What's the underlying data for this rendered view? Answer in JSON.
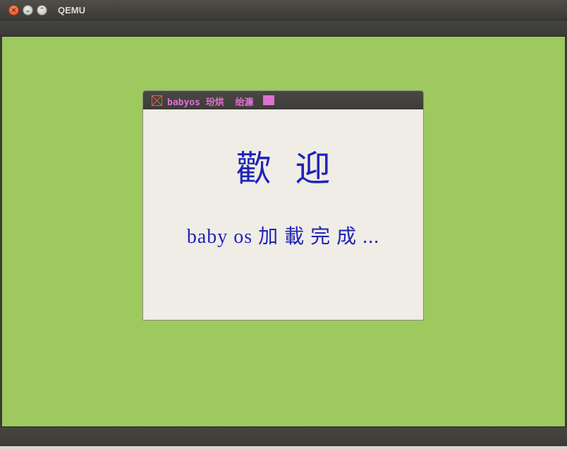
{
  "window": {
    "title": "QEMU",
    "buttons": {
      "close": "×",
      "minimize": "⌄",
      "maximize": "⌃"
    }
  },
  "guest": {
    "background_color": "#9dc95e",
    "dialog": {
      "title": "babyos 玢烘  绐濂",
      "title_color": "#e070d0",
      "heading": "歡迎",
      "message": "baby os 加 載 完 成 ...",
      "text_color": "#1f24b8"
    }
  }
}
